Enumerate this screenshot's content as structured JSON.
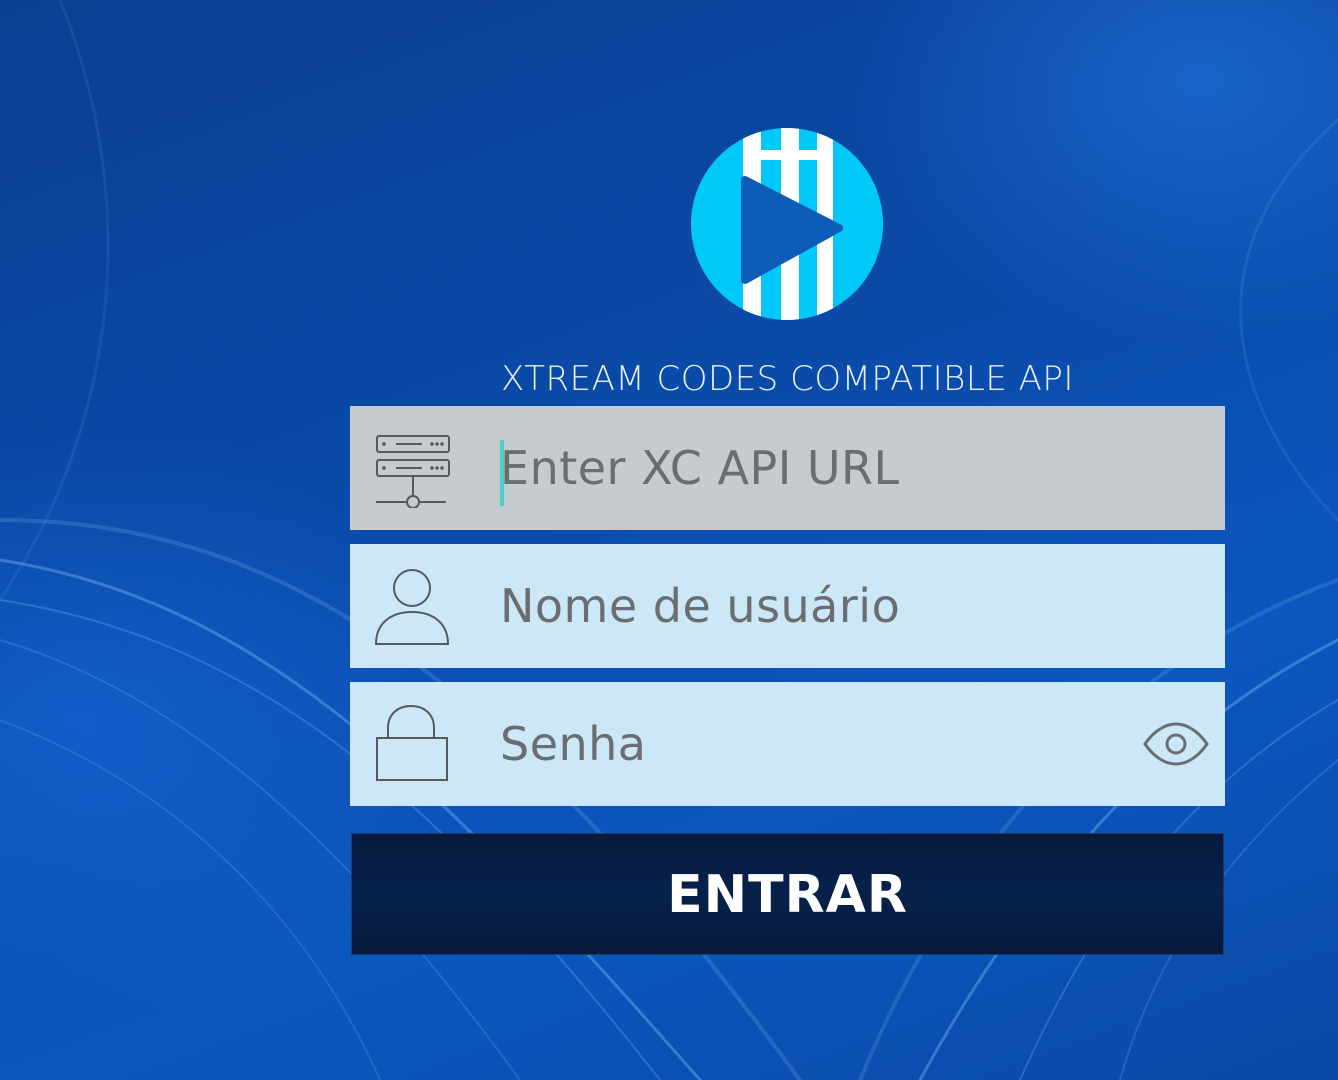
{
  "app": {
    "subtitle": "XTREAM CODES COMPATIBLE API"
  },
  "form": {
    "url": {
      "placeholder": "Enter XC API URL",
      "icon": "server-icon"
    },
    "username": {
      "placeholder": "Nome de usuário",
      "icon": "user-icon"
    },
    "password": {
      "placeholder": "Senha",
      "icon": "lock-icon",
      "toggle_icon": "eye-icon"
    },
    "submit_label": "ENTRAR"
  },
  "colors": {
    "background": "#0a47a6",
    "focused_field": "#c6cbd0",
    "field": "#cbe7f8",
    "button": "#061a3d",
    "logo_cyan": "#00c8f8",
    "logo_play": "#0d5cb8",
    "caret": "#4fd0c4"
  }
}
